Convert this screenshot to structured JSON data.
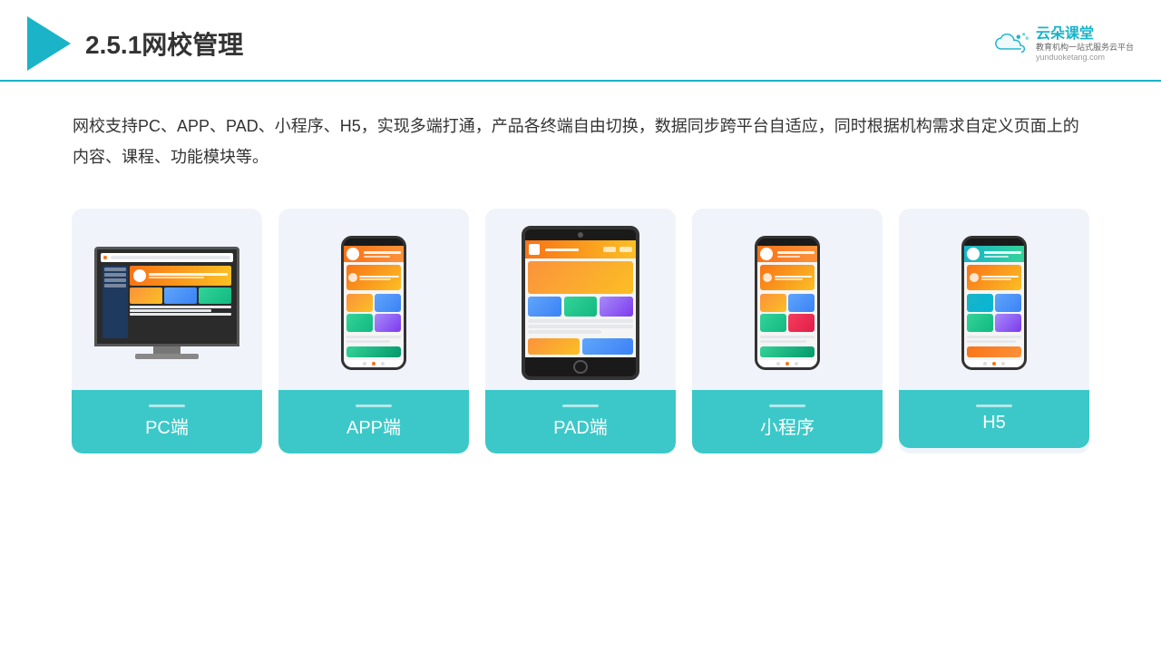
{
  "header": {
    "title": "2.5.1网校管理",
    "brand": {
      "name": "云朵课堂",
      "slogan": "教育机构一站式服务云平台",
      "domain": "yunduoketang.com"
    }
  },
  "description": "网校支持PC、APP、PAD、小程序、H5，实现多端打通，产品各终端自由切换，数据同步跨平台自适应，同时根据机构需求自定义页面上的内容、课程、功能模块等。",
  "cards": [
    {
      "id": "pc",
      "label": "PC端",
      "type": "pc"
    },
    {
      "id": "app",
      "label": "APP端",
      "type": "phone"
    },
    {
      "id": "pad",
      "label": "PAD端",
      "type": "tablet"
    },
    {
      "id": "miniprogram",
      "label": "小程序",
      "type": "phone"
    },
    {
      "id": "h5",
      "label": "H5",
      "type": "phone"
    }
  ],
  "colors": {
    "accent": "#1ab3c8",
    "teal": "#3cc8c8",
    "card_bg": "#f0f4fa"
  }
}
